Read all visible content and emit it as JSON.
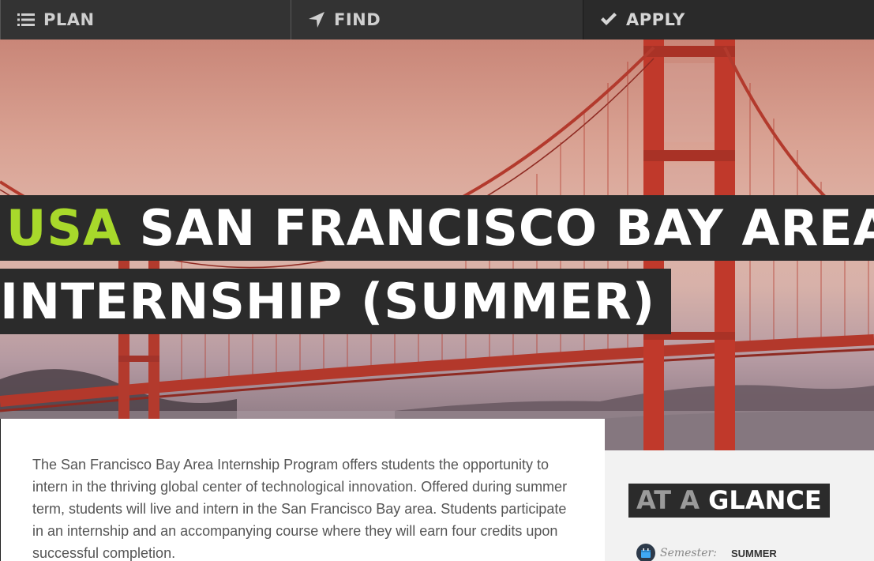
{
  "nav": {
    "items": [
      {
        "label": "PLAN",
        "icon": "list-icon"
      },
      {
        "label": "FIND",
        "icon": "location-arrow-icon"
      },
      {
        "label": "APPLY",
        "icon": "checkmark-icon"
      }
    ]
  },
  "hero": {
    "title_accent": "USA",
    "title_line1": "SAN FRANCISCO BAY AREA",
    "title_line2": "INTERNSHIP (SUMMER)",
    "image": "golden-gate-bridge"
  },
  "main": {
    "description": "The San Francisco Bay Area Internship Program offers students the opportunity to intern in the thriving global center of technological innovation. Offered during summer term, students will live and intern in the San Francisco Bay area. Students participate in an internship and an accompanying course where they will earn four credits upon successful completion."
  },
  "glance": {
    "heading_dim": "AT A",
    "heading_main": "GLANCE",
    "rows": [
      {
        "label": "Semester:",
        "value": "SUMMER",
        "icon": "calendar-icon"
      }
    ]
  },
  "colors": {
    "accent": "#a8d92b",
    "nav_bg": "#333333",
    "title_bg": "#2b2b2b",
    "bridge_red": "#c0392b"
  }
}
